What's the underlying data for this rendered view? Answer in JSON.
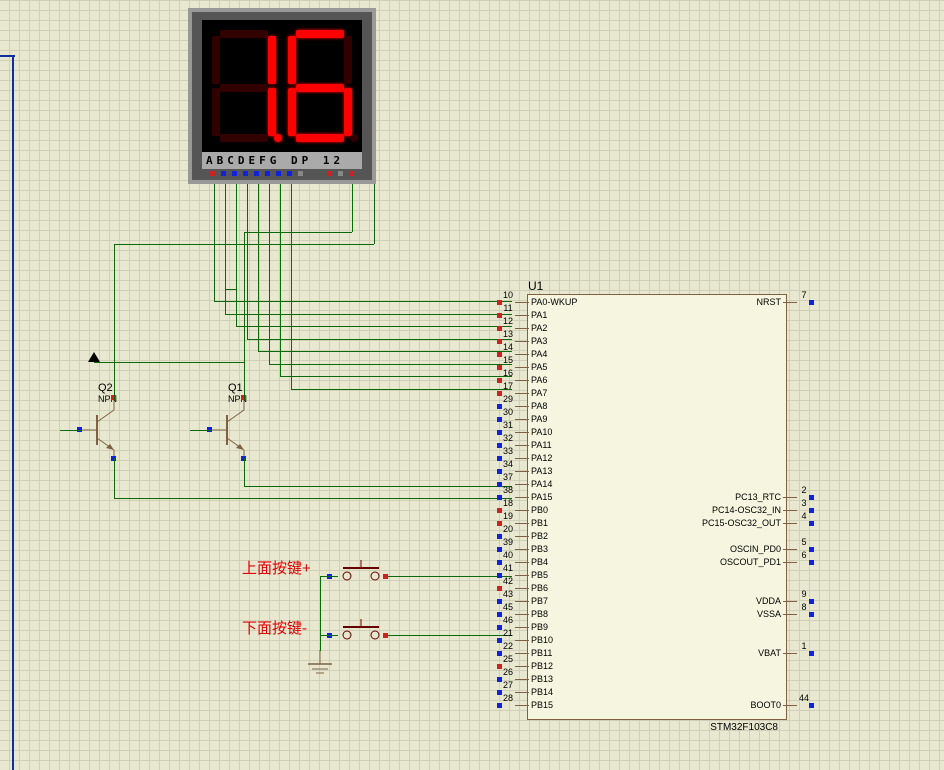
{
  "display": {
    "segment_labels": "ABCDEFG DP  12",
    "digit1": "1",
    "digit2": "6"
  },
  "chip": {
    "ref": "U1",
    "name": "STM32F103C8",
    "left_pins": [
      {
        "num": "10",
        "name": "PA0-WKUP"
      },
      {
        "num": "11",
        "name": "PA1"
      },
      {
        "num": "12",
        "name": "PA2"
      },
      {
        "num": "13",
        "name": "PA3"
      },
      {
        "num": "14",
        "name": "PA4"
      },
      {
        "num": "15",
        "name": "PA5"
      },
      {
        "num": "16",
        "name": "PA6"
      },
      {
        "num": "17",
        "name": "PA7"
      },
      {
        "num": "29",
        "name": "PA8"
      },
      {
        "num": "30",
        "name": "PA9"
      },
      {
        "num": "31",
        "name": "PA10"
      },
      {
        "num": "32",
        "name": "PA11"
      },
      {
        "num": "33",
        "name": "PA12"
      },
      {
        "num": "34",
        "name": "PA13"
      },
      {
        "num": "37",
        "name": "PA14"
      },
      {
        "num": "38",
        "name": "PA15"
      },
      {
        "num": "18",
        "name": "PB0"
      },
      {
        "num": "19",
        "name": "PB1"
      },
      {
        "num": "20",
        "name": "PB2"
      },
      {
        "num": "39",
        "name": "PB3"
      },
      {
        "num": "40",
        "name": "PB4"
      },
      {
        "num": "41",
        "name": "PB5"
      },
      {
        "num": "42",
        "name": "PB6"
      },
      {
        "num": "43",
        "name": "PB7"
      },
      {
        "num": "45",
        "name": "PB8"
      },
      {
        "num": "46",
        "name": "PB9"
      },
      {
        "num": "21",
        "name": "PB10"
      },
      {
        "num": "22",
        "name": "PB11"
      },
      {
        "num": "25",
        "name": "PB12"
      },
      {
        "num": "26",
        "name": "PB13"
      },
      {
        "num": "27",
        "name": "PB14"
      },
      {
        "num": "28",
        "name": "PB15"
      }
    ],
    "right_pins": [
      {
        "num": "7",
        "name": "NRST",
        "row": 0
      },
      {
        "num": "2",
        "name": "PC13_RTC",
        "row": 15
      },
      {
        "num": "3",
        "name": "PC14-OSC32_IN",
        "row": 16
      },
      {
        "num": "4",
        "name": "PC15-OSC32_OUT",
        "row": 17
      },
      {
        "num": "5",
        "name": "OSCIN_PD0",
        "row": 19
      },
      {
        "num": "6",
        "name": "OSCOUT_PD1",
        "row": 20
      },
      {
        "num": "9",
        "name": "VDDA",
        "row": 23
      },
      {
        "num": "8",
        "name": "VSSA",
        "row": 24
      },
      {
        "num": "1",
        "name": "VBAT",
        "row": 27
      },
      {
        "num": "44",
        "name": "BOOT0",
        "row": 31
      }
    ]
  },
  "transistors": {
    "q1": {
      "ref": "Q1",
      "type": "NPN"
    },
    "q2": {
      "ref": "Q2",
      "type": "NPN"
    }
  },
  "annotations": {
    "btn_plus": "上面按键+",
    "btn_minus": "下面按键-"
  }
}
